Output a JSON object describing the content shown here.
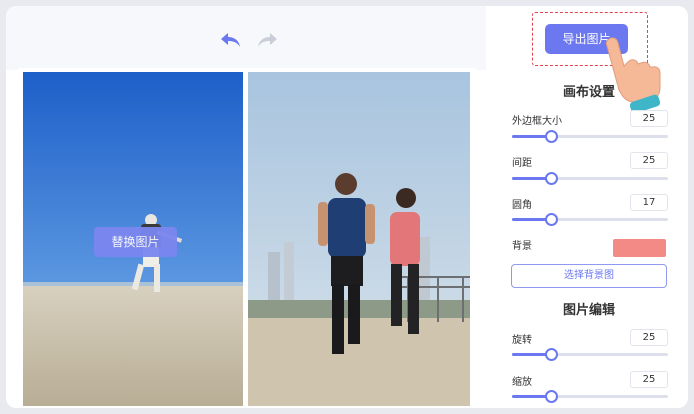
{
  "toolbar": {
    "undo_icon": "undo-arrow-icon",
    "redo_icon": "redo-arrow-icon",
    "export_label": "导出图片"
  },
  "canvas": {
    "replace_label": "替换图片"
  },
  "canvas_settings": {
    "title": "画布设置",
    "border_size": {
      "label": "外边框大小",
      "value": "25",
      "level": 0.25
    },
    "spacing": {
      "label": "间距",
      "value": "25",
      "level": 0.25
    },
    "corner": {
      "label": "圆角",
      "value": "17",
      "level": 0.25
    },
    "background": {
      "label": "背景",
      "color": "#f48a86"
    },
    "choose_bg_label": "选择背景图"
  },
  "image_edit": {
    "title": "图片编辑",
    "rotate": {
      "label": "旋转",
      "value": "25",
      "level": 0.25
    },
    "zoom": {
      "label": "缩放",
      "value": "25",
      "level": 0.25
    }
  },
  "colors": {
    "accent": "#6b78f0",
    "highlight_border": "#e0454f"
  }
}
